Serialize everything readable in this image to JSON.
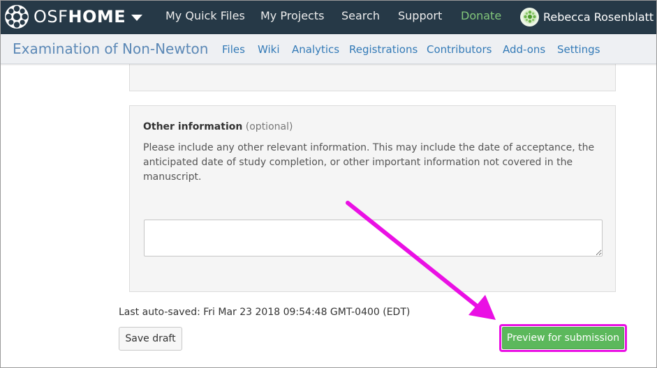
{
  "topnav": {
    "brand_light": "OSF",
    "brand_bold": "HOME",
    "links": [
      "My Quick Files",
      "My Projects",
      "Search",
      "Support",
      "Donate"
    ],
    "user_name": "Rebecca Rosenblatt"
  },
  "projnav": {
    "title": "Examination of Non-Newtoni...",
    "links": [
      "Files",
      "Wiki",
      "Analytics",
      "Registrations",
      "Contributors",
      "Add-ons",
      "Settings"
    ]
  },
  "form": {
    "section_title": "Other information",
    "section_optional": "(optional)",
    "description": "Please include any other relevant information. This may include the date of acceptance, the anticipated date of study completion, or other important information not covered in the manuscript.",
    "textarea_value": ""
  },
  "footer": {
    "autosave": "Last auto-saved: Fri Mar 23 2018 09:54:48 GMT-0400 (EDT)",
    "save_label": "Save draft",
    "preview_label": "Preview for submission"
  },
  "colors": {
    "topnav_bg": "#263947",
    "donate": "#82c67a",
    "link": "#337ab7",
    "success_button": "#5cb85c",
    "annotation": "#ea10e4"
  },
  "icons": {
    "brand": "osf-logo-icon",
    "brand_menu": "chevron-down-icon",
    "avatar": "user-avatar-icon",
    "annotation": "arrow-annotation-icon"
  }
}
